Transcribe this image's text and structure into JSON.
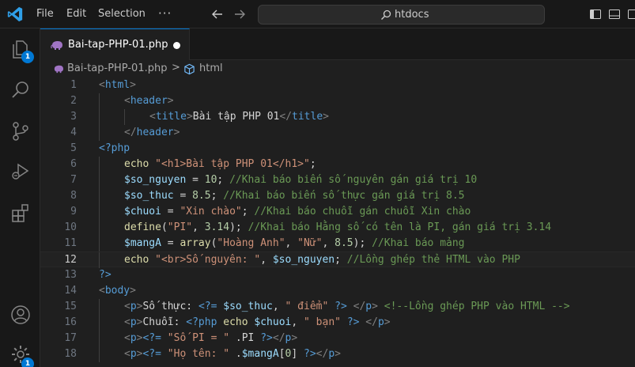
{
  "titlebar": {
    "menu": [
      "File",
      "Edit",
      "Selection"
    ],
    "more": "···",
    "search_text": "htdocs"
  },
  "activitybar": {
    "explorer_badge": "1",
    "accounts_badge": "1"
  },
  "tab": {
    "label": "Bai-tap-PHP-01.php"
  },
  "breadcrumb": {
    "file": "Bai-tap-PHP-01.php",
    "separator": ">",
    "symbol": "html"
  },
  "editor": {
    "active_line": 12,
    "lines": [
      {
        "n": "1",
        "indent": 0,
        "tokens": [
          [
            "t-br",
            "<"
          ],
          [
            "t-tag",
            "html"
          ],
          [
            "t-br",
            ">"
          ]
        ]
      },
      {
        "n": "2",
        "indent": 1,
        "tokens": [
          [
            "t-br",
            "<"
          ],
          [
            "t-tag",
            "header"
          ],
          [
            "t-br",
            ">"
          ]
        ]
      },
      {
        "n": "3",
        "indent": 2,
        "tokens": [
          [
            "t-br",
            "<"
          ],
          [
            "t-tag",
            "title"
          ],
          [
            "t-br",
            ">"
          ],
          [
            "t-txt",
            "Bài tập PHP 01"
          ],
          [
            "t-br",
            "</"
          ],
          [
            "t-tag",
            "title"
          ],
          [
            "t-br",
            ">"
          ]
        ]
      },
      {
        "n": "4",
        "indent": 1,
        "tokens": [
          [
            "t-br",
            "</"
          ],
          [
            "t-tag",
            "header"
          ],
          [
            "t-br",
            ">"
          ]
        ]
      },
      {
        "n": "5",
        "indent": 0,
        "tokens": [
          [
            "t-tag",
            "<?php"
          ]
        ]
      },
      {
        "n": "6",
        "indent": 1,
        "tokens": [
          [
            "t-fn",
            "echo"
          ],
          [
            "t-txt",
            " "
          ],
          [
            "t-str",
            "\"<h1>Bài tập PHP 01</h1>\""
          ],
          [
            "t-txt",
            ";"
          ]
        ]
      },
      {
        "n": "7",
        "indent": 1,
        "tokens": [
          [
            "t-var",
            "$so_nguyen"
          ],
          [
            "t-txt",
            " = "
          ],
          [
            "t-num",
            "10"
          ],
          [
            "t-txt",
            "; "
          ],
          [
            "t-cmt",
            "//Khai báo biến số nguyên gán giá trị 10"
          ]
        ]
      },
      {
        "n": "8",
        "indent": 1,
        "tokens": [
          [
            "t-var",
            "$so_thuc"
          ],
          [
            "t-txt",
            " = "
          ],
          [
            "t-num",
            "8.5"
          ],
          [
            "t-txt",
            "; "
          ],
          [
            "t-cmt",
            "//Khai báo biến số thực gán giá trị 8.5"
          ]
        ]
      },
      {
        "n": "9",
        "indent": 1,
        "tokens": [
          [
            "t-var",
            "$chuoi"
          ],
          [
            "t-txt",
            " = "
          ],
          [
            "t-str",
            "\"Xin chào\""
          ],
          [
            "t-txt",
            "; "
          ],
          [
            "t-cmt",
            "//Khai báo chuỗi gán chuỗi Xin chào"
          ]
        ]
      },
      {
        "n": "10",
        "indent": 1,
        "tokens": [
          [
            "t-fn",
            "define"
          ],
          [
            "t-txt",
            "("
          ],
          [
            "t-str",
            "\"PI\""
          ],
          [
            "t-txt",
            ", "
          ],
          [
            "t-num",
            "3.14"
          ],
          [
            "t-txt",
            "); "
          ],
          [
            "t-cmt",
            "//Khai báo Hằng số có tên là PI, gán giá trị 3.14"
          ]
        ]
      },
      {
        "n": "11",
        "indent": 1,
        "tokens": [
          [
            "t-var",
            "$mangA"
          ],
          [
            "t-txt",
            " = "
          ],
          [
            "t-fn",
            "array"
          ],
          [
            "t-txt",
            "("
          ],
          [
            "t-str",
            "\"Hoàng Anh\""
          ],
          [
            "t-txt",
            ", "
          ],
          [
            "t-str",
            "\"Nữ\""
          ],
          [
            "t-txt",
            ", "
          ],
          [
            "t-num",
            "8.5"
          ],
          [
            "t-txt",
            "); "
          ],
          [
            "t-cmt",
            "//Khai báo mảng"
          ]
        ]
      },
      {
        "n": "12",
        "indent": 1,
        "tokens": [
          [
            "t-fn",
            "echo"
          ],
          [
            "t-txt",
            " "
          ],
          [
            "t-str",
            "\"<br>Số nguyên: \""
          ],
          [
            "t-txt",
            ", "
          ],
          [
            "t-var",
            "$so_nguyen"
          ],
          [
            "t-txt",
            "; "
          ],
          [
            "t-cmt",
            "//Lồng ghép thẻ HTML vào PHP"
          ]
        ]
      },
      {
        "n": "13",
        "indent": 0,
        "tokens": [
          [
            "t-tag",
            "?>"
          ]
        ]
      },
      {
        "n": "14",
        "indent": 0,
        "tokens": [
          [
            "t-br",
            "<"
          ],
          [
            "t-tag",
            "body"
          ],
          [
            "t-br",
            ">"
          ]
        ]
      },
      {
        "n": "15",
        "indent": 1,
        "tokens": [
          [
            "t-br",
            "<"
          ],
          [
            "t-tag",
            "p"
          ],
          [
            "t-br",
            ">"
          ],
          [
            "t-txt",
            "Số thực: "
          ],
          [
            "t-tag",
            "<?="
          ],
          [
            "t-txt",
            " "
          ],
          [
            "t-var",
            "$so_thuc"
          ],
          [
            "t-txt",
            ", "
          ],
          [
            "t-str",
            "\" điểm\""
          ],
          [
            "t-txt",
            " "
          ],
          [
            "t-tag",
            "?>"
          ],
          [
            "t-txt",
            " "
          ],
          [
            "t-br",
            "</"
          ],
          [
            "t-tag",
            "p"
          ],
          [
            "t-br",
            ">"
          ],
          [
            "t-txt",
            " "
          ],
          [
            "t-cmt",
            "<!--Lồng ghép PHP vào HTML -->"
          ]
        ]
      },
      {
        "n": "16",
        "indent": 1,
        "tokens": [
          [
            "t-br",
            "<"
          ],
          [
            "t-tag",
            "p"
          ],
          [
            "t-br",
            ">"
          ],
          [
            "t-txt",
            "Chuỗi: "
          ],
          [
            "t-tag",
            "<?php"
          ],
          [
            "t-txt",
            " "
          ],
          [
            "t-fn",
            "echo"
          ],
          [
            "t-txt",
            " "
          ],
          [
            "t-var",
            "$chuoi"
          ],
          [
            "t-txt",
            ", "
          ],
          [
            "t-str",
            "\" bạn\""
          ],
          [
            "t-txt",
            " "
          ],
          [
            "t-tag",
            "?>"
          ],
          [
            "t-txt",
            " "
          ],
          [
            "t-br",
            "</"
          ],
          [
            "t-tag",
            "p"
          ],
          [
            "t-br",
            ">"
          ]
        ]
      },
      {
        "n": "17",
        "indent": 1,
        "tokens": [
          [
            "t-br",
            "<"
          ],
          [
            "t-tag",
            "p"
          ],
          [
            "t-br",
            ">"
          ],
          [
            "t-tag",
            "<?="
          ],
          [
            "t-txt",
            " "
          ],
          [
            "t-str",
            "\"Số PI = \""
          ],
          [
            "t-txt",
            " ."
          ],
          [
            "t-txt",
            "PI"
          ],
          [
            "t-txt",
            " "
          ],
          [
            "t-tag",
            "?>"
          ],
          [
            "t-br",
            "</"
          ],
          [
            "t-tag",
            "p"
          ],
          [
            "t-br",
            ">"
          ]
        ]
      },
      {
        "n": "18",
        "indent": 1,
        "tokens": [
          [
            "t-br",
            "<"
          ],
          [
            "t-tag",
            "p"
          ],
          [
            "t-br",
            ">"
          ],
          [
            "t-tag",
            "<?="
          ],
          [
            "t-txt",
            " "
          ],
          [
            "t-str",
            "\"Họ tên: \""
          ],
          [
            "t-txt",
            " ."
          ],
          [
            "t-var",
            "$mangA"
          ],
          [
            "t-txt",
            "["
          ],
          [
            "t-num",
            "0"
          ],
          [
            "t-txt",
            "] "
          ],
          [
            "t-tag",
            "?>"
          ],
          [
            "t-br",
            "</"
          ],
          [
            "t-tag",
            "p"
          ],
          [
            "t-br",
            ">"
          ]
        ]
      }
    ]
  }
}
